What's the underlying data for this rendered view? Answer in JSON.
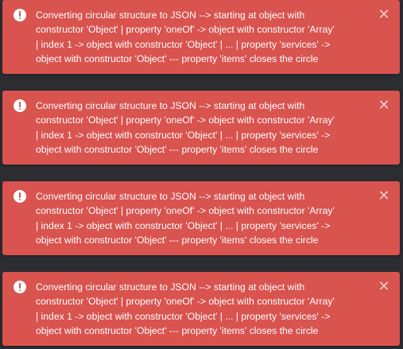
{
  "colors": {
    "toast_background": "#d9534f",
    "text": "#ffffff",
    "page_background": "#2b2d31"
  },
  "icons": {
    "alert": "exclamation-circle-icon",
    "close": "close-icon"
  },
  "close_glyph": "✕",
  "toasts": [
    {
      "message": "Converting circular structure to JSON --> starting at object with\nconstructor 'Object' | property 'oneOf' -> object with constructor 'Array'\n| index 1 -> object with constructor 'Object' | ... | property 'services' ->\nobject with constructor 'Object' --- property 'items' closes the circle"
    },
    {
      "message": "Converting circular structure to JSON --> starting at object with\nconstructor 'Object' | property 'oneOf' -> object with constructor 'Array'\n| index 1 -> object with constructor 'Object' | ... | property 'services' ->\nobject with constructor 'Object' --- property 'items' closes the circle"
    },
    {
      "message": "Converting circular structure to JSON --> starting at object with\nconstructor 'Object' | property 'oneOf' -> object with constructor 'Array'\n| index 1 -> object with constructor 'Object' | ... | property 'services' ->\nobject with constructor 'Object' --- property 'items' closes the circle"
    },
    {
      "message": "Converting circular structure to JSON --> starting at object with\nconstructor 'Object' | property 'oneOf' -> object with constructor 'Array'\n| index 1 -> object with constructor 'Object' | ... | property 'services' ->\nobject with constructor 'Object' --- property 'items' closes the circle"
    }
  ]
}
